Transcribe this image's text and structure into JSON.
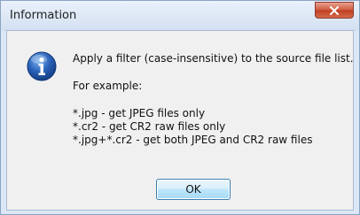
{
  "window": {
    "title": "Information",
    "close_icon": "close-icon"
  },
  "dialog": {
    "icon": "info-icon",
    "message": {
      "line1": "Apply a filter (case-insensitive) to the source file list.",
      "line2": "For example:",
      "examples": [
        "*.jpg - get JPEG files only",
        "*.cr2 - get CR2 raw files only",
        "*.jpg+*.cr2 - get both JPEG and CR2 raw files"
      ]
    },
    "ok_label": "OK"
  },
  "colors": {
    "close_button": "#c9492c",
    "ok_button_border": "#3c7fb1",
    "info_icon": "#2a62b8"
  }
}
